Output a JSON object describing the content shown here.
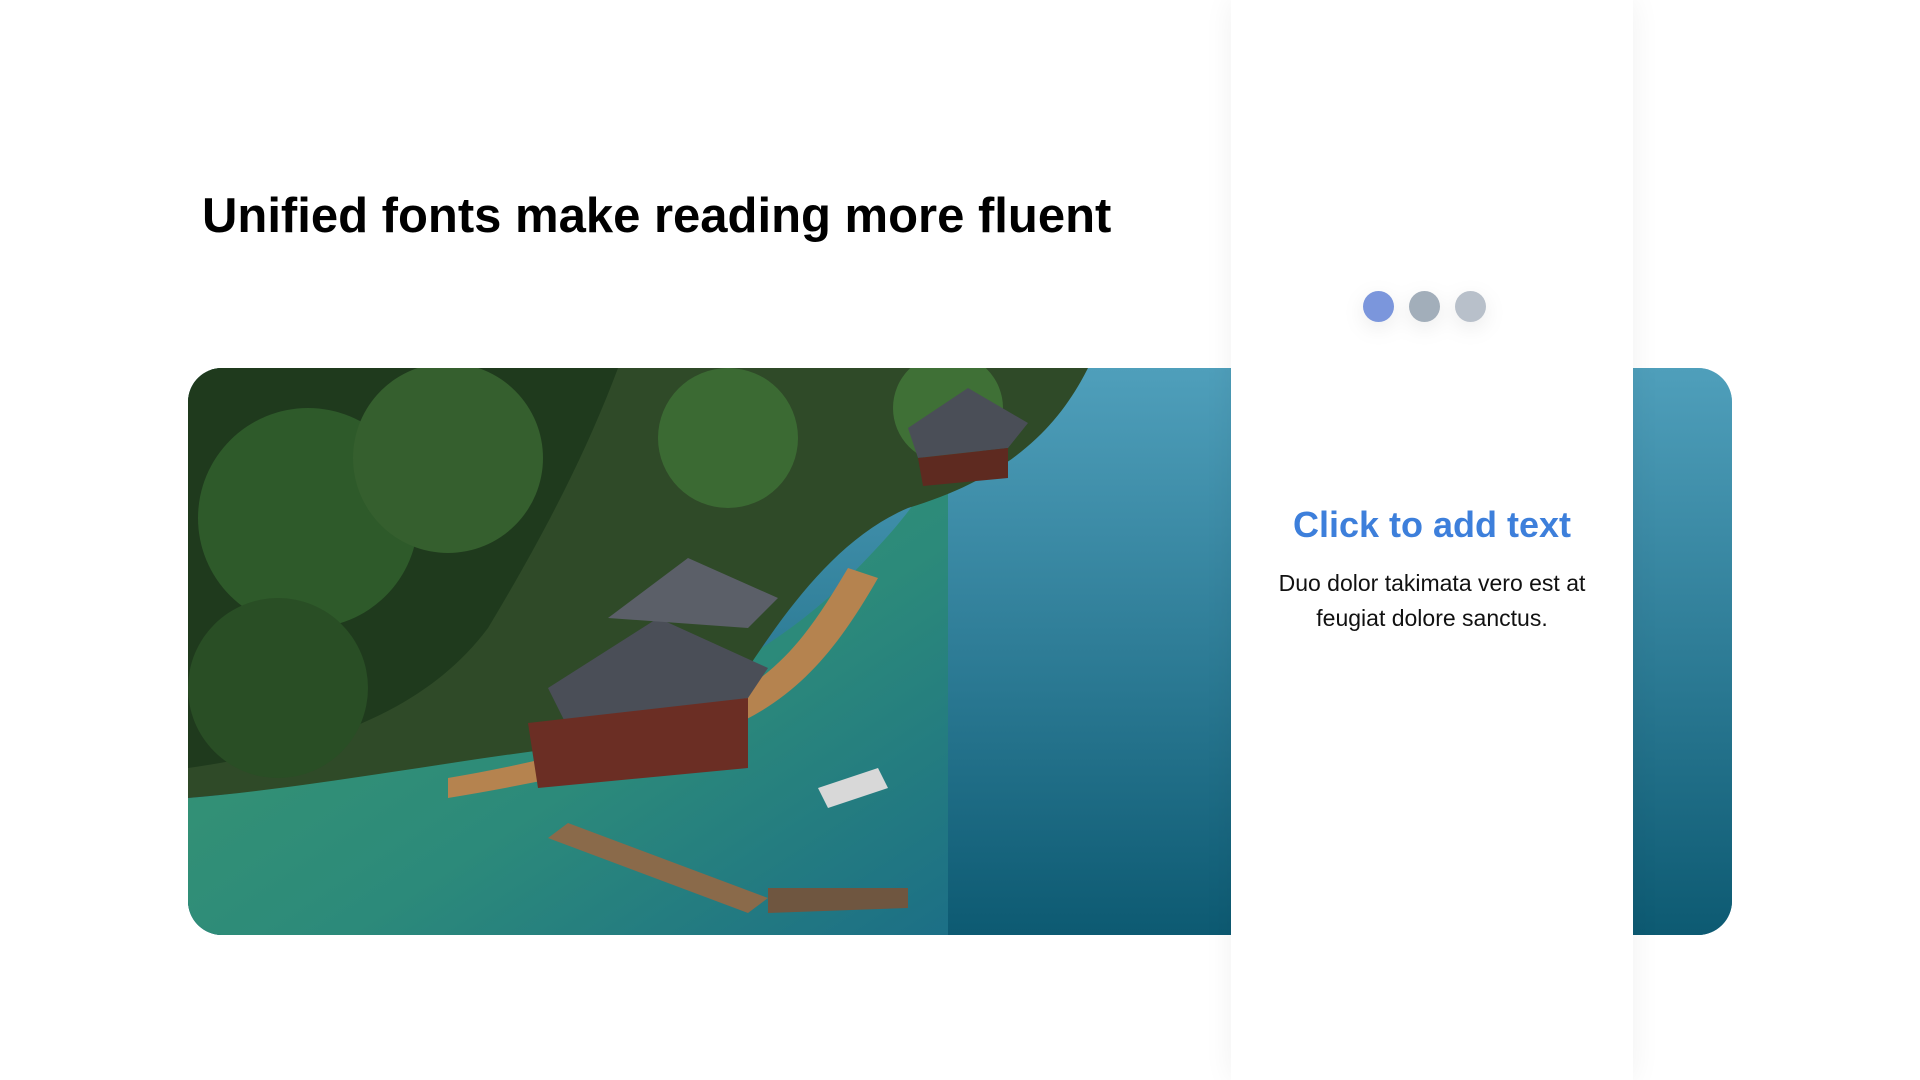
{
  "slide": {
    "title": "Unified fonts make reading more fluent"
  },
  "image": {
    "icon": "lake-landscape-photo"
  },
  "panel": {
    "heading": "Click to add text",
    "body": "Duo dolor takimata vero est at feugiat dolore sanctus.",
    "pagination": [
      {
        "color": "#7b96dc",
        "active": true
      },
      {
        "color": "#a2aeba",
        "active": false
      },
      {
        "color": "#b8c0ca",
        "active": false
      }
    ],
    "accent": "#3d7fdb"
  }
}
